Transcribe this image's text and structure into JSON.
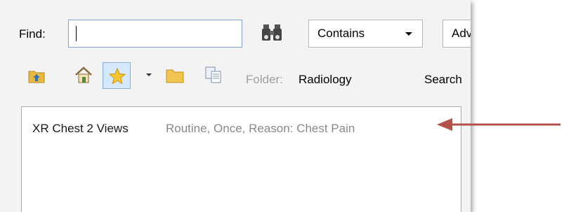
{
  "search": {
    "find_label": "Find:",
    "find_value": "",
    "match_mode": "Contains",
    "advanced_label": "Adv"
  },
  "toolbar": {
    "icons": [
      "up-folder-icon",
      "home-icon",
      "star-icon",
      "dropdown-arrow-icon",
      "folder-icon",
      "copy-icon"
    ],
    "folder_label": "Folder:",
    "folder_value": "Radiology",
    "search_label": "Search"
  },
  "results": {
    "items": [
      {
        "name": "XR Chest 2 Views",
        "details": "Routine, Once, Reason: Chest Pain"
      }
    ]
  },
  "annotation": {
    "arrow_color": "#b5504a"
  },
  "colors": {
    "input_border": "#7aa7d8",
    "selected_button_bg": "#d6e8fb"
  }
}
